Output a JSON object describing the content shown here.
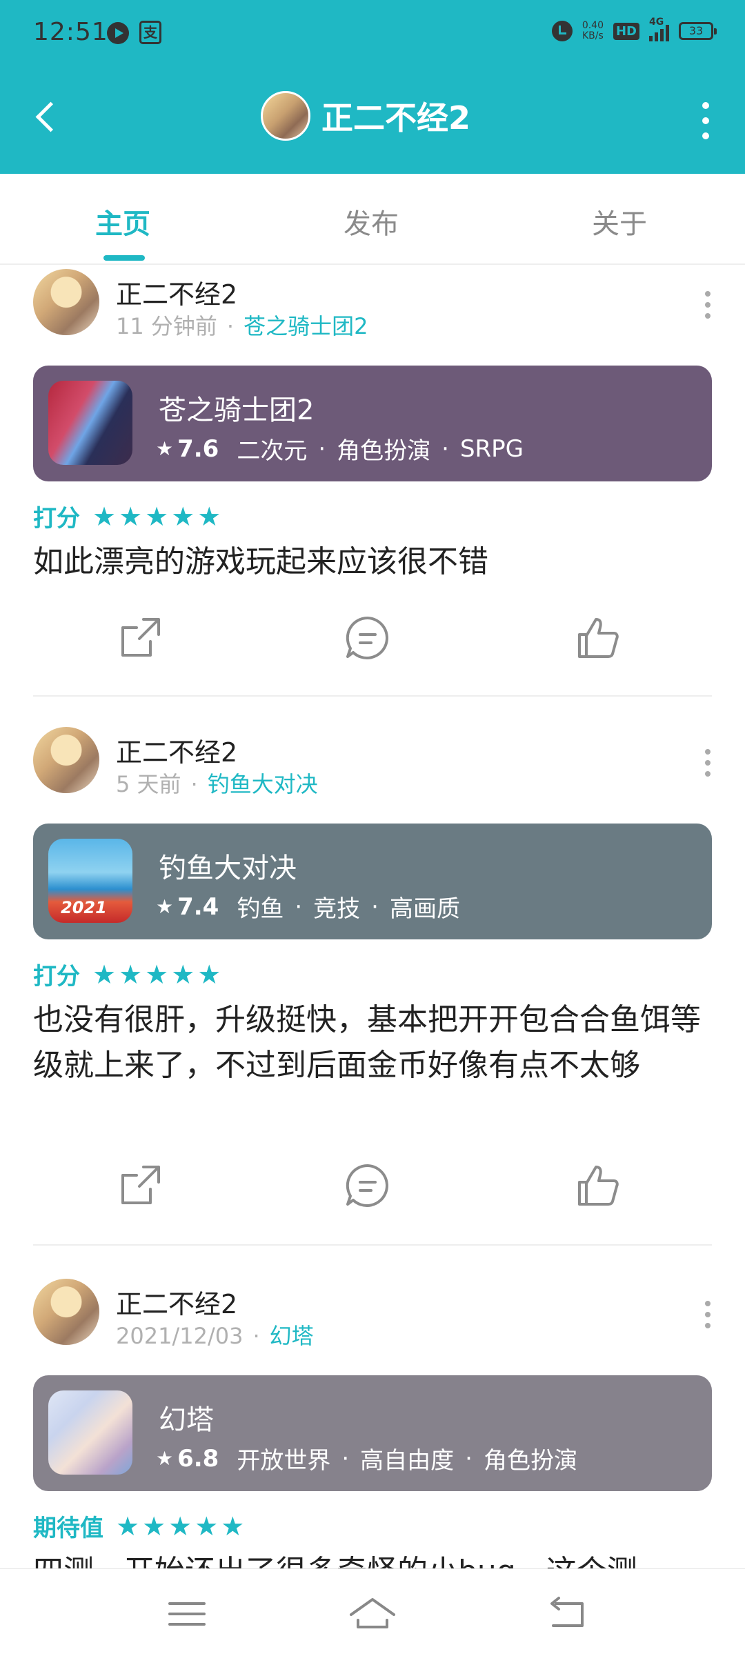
{
  "status_bar": {
    "time": "12:51",
    "net_speed_value": "0.40",
    "net_speed_unit": "KB/s",
    "hd": "HD",
    "network": "4G",
    "battery": "33"
  },
  "header": {
    "title": "正二不经2",
    "accent": "#1fb8c4"
  },
  "tabs": [
    {
      "label": "主页",
      "active": true
    },
    {
      "label": "发布",
      "active": false
    },
    {
      "label": "关于",
      "active": false
    }
  ],
  "posts": [
    {
      "user": "正二不经2",
      "time": "11 分钟前",
      "dot": "·",
      "game_link": "苍之骑士团2",
      "card": {
        "name": "苍之骑士团2",
        "score": "7.6",
        "tags": [
          "二次元",
          "角色扮演",
          "SRPG"
        ],
        "bg": "#6d5a78"
      },
      "rating_label": "打分",
      "stars": "★★★★★",
      "review": "如此漂亮的游戏玩起来应该很不错"
    },
    {
      "user": "正二不经2",
      "time": "5 天前",
      "dot": "·",
      "game_link": "钓鱼大对决",
      "card": {
        "name": "钓鱼大对决",
        "score": "7.4",
        "tags": [
          "钓鱼",
          "竞技",
          "高画质"
        ],
        "bg": "#6a7b83",
        "icon_badge": "2021"
      },
      "rating_label": "打分",
      "stars": "★★★★★",
      "review": "也没有很肝，升级挺快，基本把开开包合合鱼饵等级就上来了，不过到后面金币好像有点不太够"
    },
    {
      "user": "正二不经2",
      "time": "2021/12/03",
      "dot": "·",
      "game_link": "幻塔",
      "card": {
        "name": "幻塔",
        "score": "6.8",
        "tags": [
          "开放世界",
          "高自由度",
          "角色扮演"
        ],
        "bg": "#86828c"
      },
      "rating_label": "期待值",
      "stars": "★★★★★",
      "review": "四测，开始还出了很多奇怪的小bug，这个测"
    }
  ],
  "icons": {
    "share": "share-icon",
    "comment": "comment-icon",
    "like": "thumbs-up-icon"
  }
}
